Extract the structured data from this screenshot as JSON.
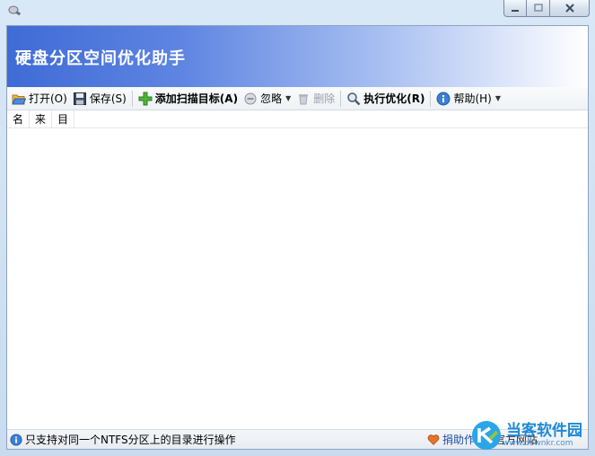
{
  "banner": {
    "title": "硬盘分区空间优化助手"
  },
  "toolbar": {
    "open_label": "打开(O)",
    "save_label": "保存(S)",
    "add_target_label": "添加扫描目标(A)",
    "ignore_label": "忽略",
    "delete_label": "删除",
    "optimize_label": "执行优化(R)",
    "help_label": "帮助(H)"
  },
  "list": {
    "columns": [
      "名",
      "来",
      "目"
    ]
  },
  "status": {
    "info_text": "只支持对同一个NTFS分区上的目录进行操作",
    "donate_label": "捐助作者",
    "site_label": "官方网站"
  },
  "watermark": {
    "brand": "当客软件园",
    "url": "www.downkr.com"
  },
  "colors": {
    "banner_start": "#3f6bd6",
    "accent": "#1f4fa8"
  }
}
